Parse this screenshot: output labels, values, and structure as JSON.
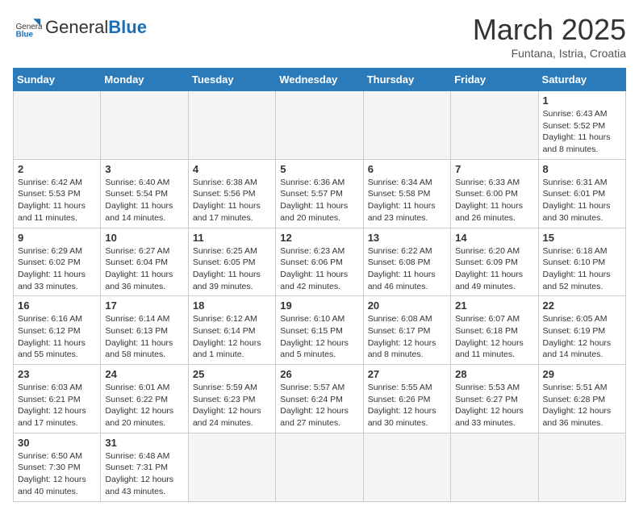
{
  "header": {
    "logo_general": "General",
    "logo_blue": "Blue",
    "month_title": "March 2025",
    "subtitle": "Funtana, Istria, Croatia"
  },
  "weekdays": [
    "Sunday",
    "Monday",
    "Tuesday",
    "Wednesday",
    "Thursday",
    "Friday",
    "Saturday"
  ],
  "weeks": [
    [
      null,
      null,
      null,
      null,
      null,
      null,
      {
        "day": "1",
        "sunrise": "6:43 AM",
        "sunset": "5:52 PM",
        "daylight": "11 hours and 8 minutes."
      }
    ],
    [
      {
        "day": "2",
        "sunrise": "6:42 AM",
        "sunset": "5:53 PM",
        "daylight": "11 hours and 11 minutes."
      },
      {
        "day": "3",
        "sunrise": "6:40 AM",
        "sunset": "5:54 PM",
        "daylight": "11 hours and 14 minutes."
      },
      {
        "day": "4",
        "sunrise": "6:38 AM",
        "sunset": "5:56 PM",
        "daylight": "11 hours and 17 minutes."
      },
      {
        "day": "5",
        "sunrise": "6:36 AM",
        "sunset": "5:57 PM",
        "daylight": "11 hours and 20 minutes."
      },
      {
        "day": "6",
        "sunrise": "6:34 AM",
        "sunset": "5:58 PM",
        "daylight": "11 hours and 23 minutes."
      },
      {
        "day": "7",
        "sunrise": "6:33 AM",
        "sunset": "6:00 PM",
        "daylight": "11 hours and 26 minutes."
      },
      {
        "day": "8",
        "sunrise": "6:31 AM",
        "sunset": "6:01 PM",
        "daylight": "11 hours and 30 minutes."
      }
    ],
    [
      {
        "day": "9",
        "sunrise": "6:29 AM",
        "sunset": "6:02 PM",
        "daylight": "11 hours and 33 minutes."
      },
      {
        "day": "10",
        "sunrise": "6:27 AM",
        "sunset": "6:04 PM",
        "daylight": "11 hours and 36 minutes."
      },
      {
        "day": "11",
        "sunrise": "6:25 AM",
        "sunset": "6:05 PM",
        "daylight": "11 hours and 39 minutes."
      },
      {
        "day": "12",
        "sunrise": "6:23 AM",
        "sunset": "6:06 PM",
        "daylight": "11 hours and 42 minutes."
      },
      {
        "day": "13",
        "sunrise": "6:22 AM",
        "sunset": "6:08 PM",
        "daylight": "11 hours and 46 minutes."
      },
      {
        "day": "14",
        "sunrise": "6:20 AM",
        "sunset": "6:09 PM",
        "daylight": "11 hours and 49 minutes."
      },
      {
        "day": "15",
        "sunrise": "6:18 AM",
        "sunset": "6:10 PM",
        "daylight": "11 hours and 52 minutes."
      }
    ],
    [
      {
        "day": "16",
        "sunrise": "6:16 AM",
        "sunset": "6:12 PM",
        "daylight": "11 hours and 55 minutes."
      },
      {
        "day": "17",
        "sunrise": "6:14 AM",
        "sunset": "6:13 PM",
        "daylight": "11 hours and 58 minutes."
      },
      {
        "day": "18",
        "sunrise": "6:12 AM",
        "sunset": "6:14 PM",
        "daylight": "12 hours and 1 minute."
      },
      {
        "day": "19",
        "sunrise": "6:10 AM",
        "sunset": "6:15 PM",
        "daylight": "12 hours and 5 minutes."
      },
      {
        "day": "20",
        "sunrise": "6:08 AM",
        "sunset": "6:17 PM",
        "daylight": "12 hours and 8 minutes."
      },
      {
        "day": "21",
        "sunrise": "6:07 AM",
        "sunset": "6:18 PM",
        "daylight": "12 hours and 11 minutes."
      },
      {
        "day": "22",
        "sunrise": "6:05 AM",
        "sunset": "6:19 PM",
        "daylight": "12 hours and 14 minutes."
      }
    ],
    [
      {
        "day": "23",
        "sunrise": "6:03 AM",
        "sunset": "6:21 PM",
        "daylight": "12 hours and 17 minutes."
      },
      {
        "day": "24",
        "sunrise": "6:01 AM",
        "sunset": "6:22 PM",
        "daylight": "12 hours and 20 minutes."
      },
      {
        "day": "25",
        "sunrise": "5:59 AM",
        "sunset": "6:23 PM",
        "daylight": "12 hours and 24 minutes."
      },
      {
        "day": "26",
        "sunrise": "5:57 AM",
        "sunset": "6:24 PM",
        "daylight": "12 hours and 27 minutes."
      },
      {
        "day": "27",
        "sunrise": "5:55 AM",
        "sunset": "6:26 PM",
        "daylight": "12 hours and 30 minutes."
      },
      {
        "day": "28",
        "sunrise": "5:53 AM",
        "sunset": "6:27 PM",
        "daylight": "12 hours and 33 minutes."
      },
      {
        "day": "29",
        "sunrise": "5:51 AM",
        "sunset": "6:28 PM",
        "daylight": "12 hours and 36 minutes."
      }
    ],
    [
      {
        "day": "30",
        "sunrise": "6:50 AM",
        "sunset": "7:30 PM",
        "daylight": "12 hours and 40 minutes."
      },
      {
        "day": "31",
        "sunrise": "6:48 AM",
        "sunset": "7:31 PM",
        "daylight": "12 hours and 43 minutes."
      },
      null,
      null,
      null,
      null,
      null
    ]
  ]
}
